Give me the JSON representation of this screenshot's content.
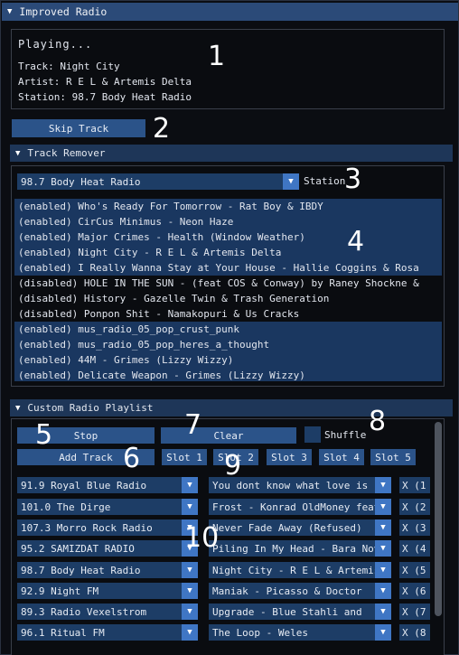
{
  "window": {
    "title": "Improved Radio"
  },
  "now_playing": {
    "status": "Playing...",
    "track": "Track: Night City",
    "artist": "Artist: R E L & Artemis Delta",
    "station": "Station: 98.7 Body Heat Radio"
  },
  "skip_button": "Skip Track",
  "track_remover": {
    "header": "Track Remover",
    "station_value": "98.7 Body Heat Radio",
    "station_label": "Station",
    "tracks": [
      "(enabled) Who's Ready For Tomorrow - Rat Boy & IBDY",
      "(enabled) CirCus Minimus - Neon Haze",
      "(enabled) Major Crimes - Health (Window Weather)",
      "(enabled) Night City - R E L & Artemis Delta",
      "(enabled) I Really Wanna Stay at Your House - Hallie Coggins & Rosa",
      "(disabled) HOLE IN THE SUN - (feat COS & Conway) by Raney Shockne &",
      "(disabled) History - Gazelle Twin & Trash Generation",
      "(disabled) Ponpon Shit - Namakopuri & Us Cracks",
      "(enabled) mus_radio_05_pop_crust_punk",
      "(enabled) mus_radio_05_pop_heres_a_thought",
      "(enabled) 44M - Grimes (Lizzy Wizzy)",
      "(enabled) Delicate Weapon  - Grimes (Lizzy Wizzy)"
    ]
  },
  "custom_playlist": {
    "header": "Custom Radio Playlist",
    "stop": "Stop",
    "clear": "Clear",
    "shuffle": "Shuffle",
    "add_track": "Add Track",
    "slots": [
      "Slot 1",
      "Slot 2",
      "Slot 3",
      "Slot 4",
      "Slot 5"
    ],
    "rows": [
      {
        "station": "91.9 Royal Blue Radio",
        "track": "You dont know what love is",
        "remove": "X (1"
      },
      {
        "station": "101.0 The Dirge",
        "track": "Frost - Konrad OldMoney feat",
        "remove": "X (2"
      },
      {
        "station": "107.3 Morro Rock Radio",
        "track": "Never Fade Away (Refused)",
        "remove": "X (3"
      },
      {
        "station": "95.2 SAMIZDAT RADIO",
        "track": "Piling In My Head - Bara Nova",
        "remove": "X (4"
      },
      {
        "station": "98.7 Body Heat Radio",
        "track": "Night City - R E L & Artemis",
        "remove": "X (5"
      },
      {
        "station": "92.9 Night FM",
        "track": "Maniak - Picasso & Doctor",
        "remove": "X (6"
      },
      {
        "station": "89.3 Radio Vexelstrom",
        "track": "Upgrade - Blue Stahli and",
        "remove": "X (7"
      },
      {
        "station": "96.1 Ritual FM",
        "track": "The Loop - Weles",
        "remove": "X (8"
      }
    ]
  },
  "annotations": [
    "1",
    "2",
    "3",
    "4",
    "5",
    "6",
    "7",
    "8",
    "9",
    "10"
  ],
  "icons": {
    "collapse": "triangle-down-icon",
    "dropdown": "triangle-down-icon"
  },
  "colors": {
    "title_bar": "#2b4a78",
    "button": "#2b5389",
    "combo": "#1d3d66",
    "selected_row": "#1a3760"
  }
}
